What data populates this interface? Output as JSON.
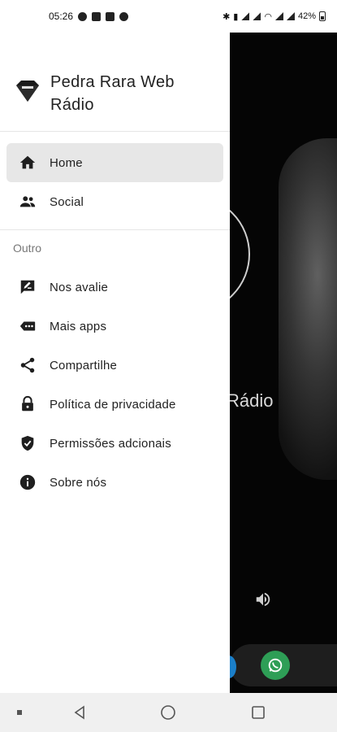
{
  "status_bar": {
    "time": "05:26",
    "battery": "42%"
  },
  "background_app": {
    "title_fragment": "Rádio"
  },
  "drawer": {
    "app_name": "Pedra Rara Web Rádio",
    "primary_items": [
      {
        "label": "Home",
        "icon": "home-icon",
        "active": true
      },
      {
        "label": "Social",
        "icon": "people-icon",
        "active": false
      }
    ],
    "section_label": "Outro",
    "secondary_items": [
      {
        "label": "Nos avalie",
        "icon": "rate-review-icon"
      },
      {
        "label": "Mais apps",
        "icon": "more-apps-icon"
      },
      {
        "label": "Compartilhe",
        "icon": "share-icon"
      },
      {
        "label": "Política de privacidade",
        "icon": "lock-icon"
      },
      {
        "label": "Permissões adcionais",
        "icon": "shield-check-icon"
      },
      {
        "label": "Sobre nós",
        "icon": "info-icon"
      }
    ]
  },
  "colors": {
    "drawer_bg": "#ffffff",
    "active_item_bg": "#e7e7e7",
    "whatsapp_green": "#2e9e56"
  }
}
